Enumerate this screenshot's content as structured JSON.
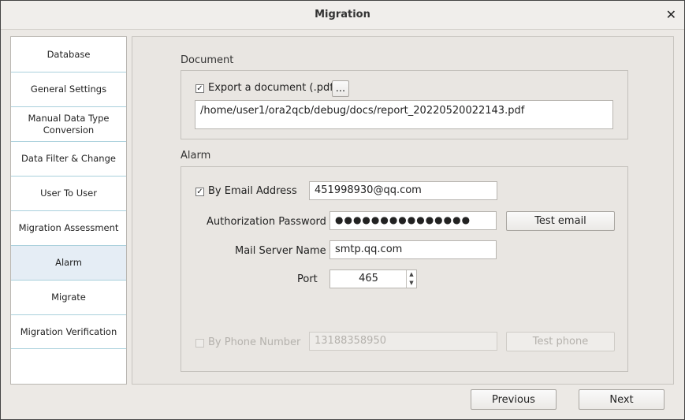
{
  "window": {
    "title": "Migration"
  },
  "sidebar": {
    "items": [
      {
        "label": "Database"
      },
      {
        "label": "General Settings"
      },
      {
        "label": "Manual Data Type Conversion"
      },
      {
        "label": "Data Filter & Change"
      },
      {
        "label": "User To User"
      },
      {
        "label": "Migration Assessment"
      },
      {
        "label": "Alarm",
        "active": true
      },
      {
        "label": "Migrate"
      },
      {
        "label": "Migration Verification"
      }
    ]
  },
  "document": {
    "section_label": "Document",
    "export_checked": true,
    "export_label": "Export a document (.pdf)",
    "browse_label": "...",
    "path": "/home/user1/ora2qcb/debug/docs/report_20220520022143.pdf"
  },
  "alarm": {
    "section_label": "Alarm",
    "email_checked": true,
    "email_label": "By Email Address",
    "email_value": "451998930@qq.com",
    "auth_label": "Authorization Password",
    "auth_value": "●●●●●●●●●●●●●●●",
    "test_email_label": "Test email",
    "server_label": "Mail Server Name",
    "server_value": "smtp.qq.com",
    "port_label": "Port",
    "port_value": "465",
    "phone_checked": false,
    "phone_label": "By Phone Number",
    "phone_value": "13188358950",
    "test_phone_label": "Test phone"
  },
  "footer": {
    "previous_label": "Previous",
    "next_label": "Next"
  }
}
